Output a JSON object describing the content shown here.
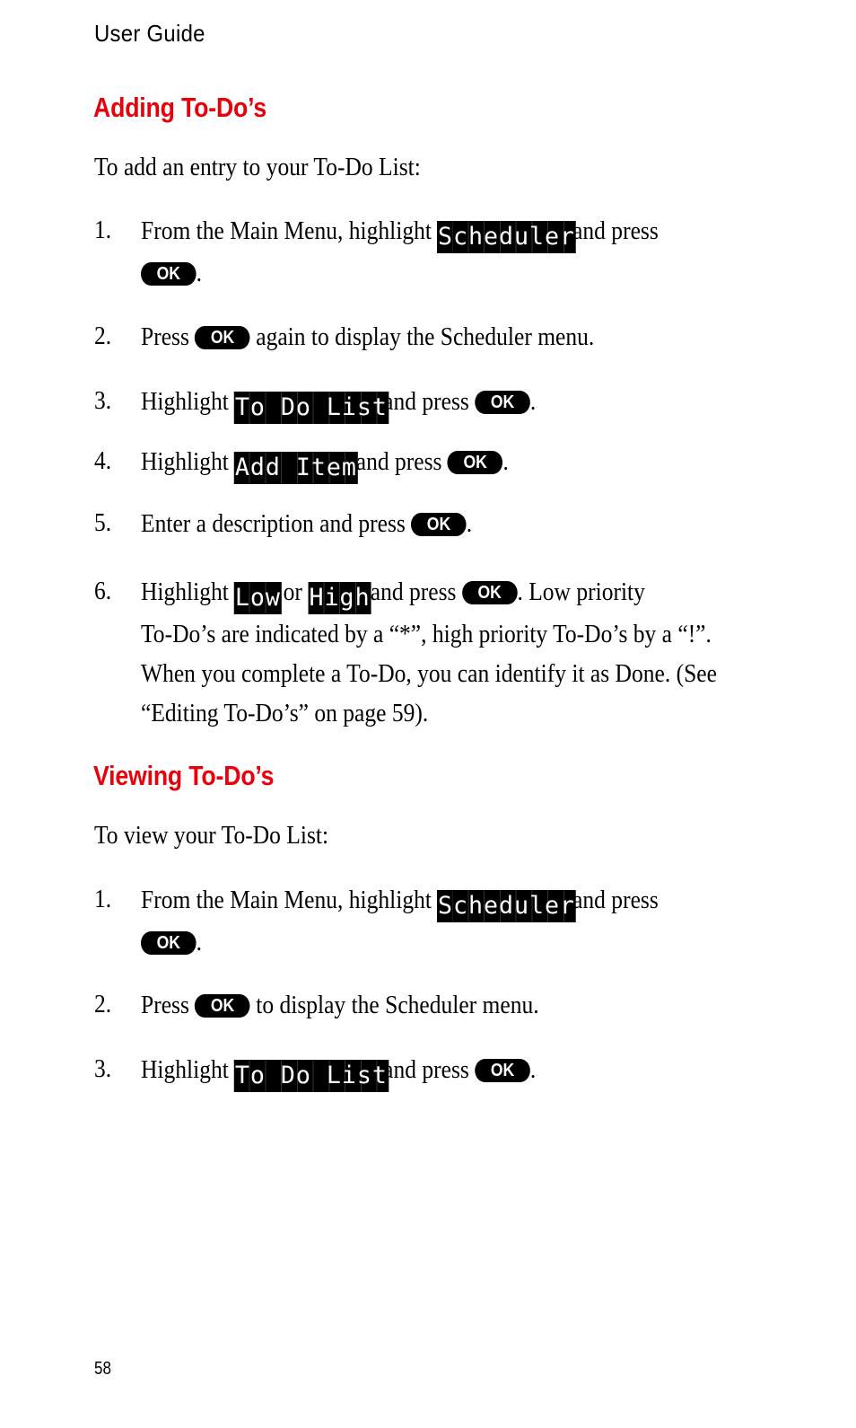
{
  "header": {
    "title": "User Guide"
  },
  "sections": [
    {
      "heading": "Adding To-Do’s",
      "intro": "To add an entry to your To-Do List:",
      "steps": [
        {
          "num": "1.",
          "t1": "From the Main Menu, highlight",
          "lcd1": "Scheduler",
          "t2": "and press",
          "ok": "OK",
          "t3": "."
        },
        {
          "num": "2.",
          "t1": "Press",
          "ok": "OK",
          "t2": "again to display the Scheduler menu."
        },
        {
          "num": "3.",
          "t1": "Highlight",
          "lcd1": "To Do List",
          "t2": "and press",
          "ok": "OK",
          "t3": "."
        },
        {
          "num": "4.",
          "t1": "Highlight",
          "lcd1": "Add Item",
          "t2": "and press",
          "ok": "OK",
          "t3": "."
        },
        {
          "num": "5.",
          "t1": "Enter a description and press",
          "ok": "OK",
          "t3": "."
        },
        {
          "num": "6.",
          "t1": "Highlight",
          "lcd1": "Low",
          "t2": "or",
          "lcd2": "High",
          "t3": "and press",
          "ok": "OK",
          "t4": ". Low priority",
          "line2": "To-Do’s are indicated by a “*”, high priority To-Do’s by a “!”.",
          "line3": "When you complete a To-Do, you can identify it as Done. (See",
          "line4": "“Editing To-Do’s” on page 59)."
        }
      ]
    },
    {
      "heading": "Viewing To-Do’s",
      "intro": "To view your To-Do List:",
      "steps": [
        {
          "num": "1.",
          "t1": "From the Main Menu, highlight",
          "lcd1": "Scheduler",
          "t2": "and press",
          "ok": "OK",
          "t3": "."
        },
        {
          "num": "2.",
          "t1": "Press",
          "ok": "OK",
          "t2": "to display the Scheduler menu."
        },
        {
          "num": "3.",
          "t1": "Highlight",
          "lcd1": "To Do List",
          "t2": "and press",
          "ok": "OK",
          "t3": "."
        }
      ]
    }
  ],
  "footer": {
    "page_number": "58"
  }
}
